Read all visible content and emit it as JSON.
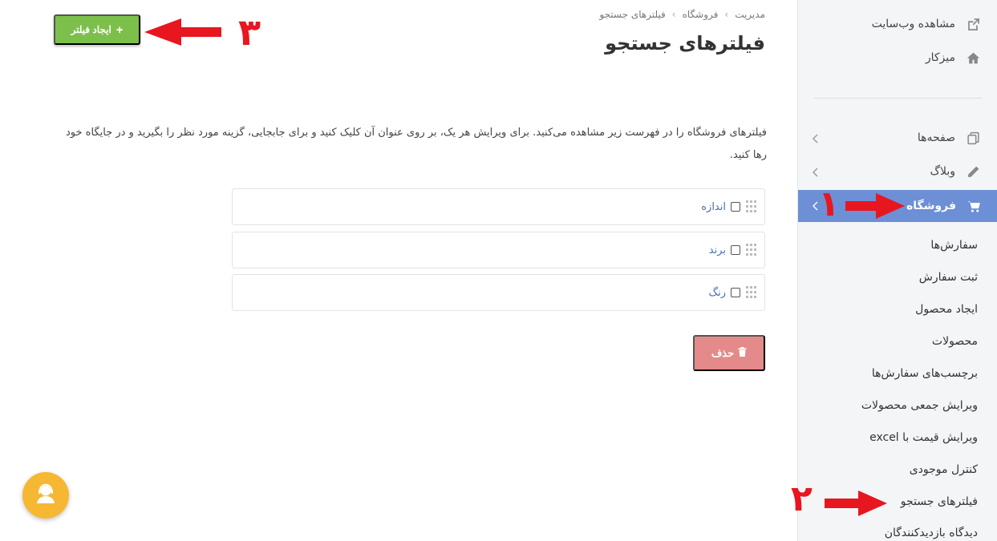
{
  "header": {
    "breadcrumb": [
      "مدیریت",
      "فروشگاه",
      "فیلترهای جستجو"
    ],
    "title": "فیلترهای جستجو",
    "create_button": "ایجاد فیلتر"
  },
  "description": "فیلترهای فروشگاه را در فهرست زیر مشاهده می‌کنید. برای ویرایش هر یک، بر روی عنوان آن کلیک کنید و برای جابجایی، گزینه مورد نظر را بگیرید و در جایگاه خود رها کنید.",
  "filters": [
    {
      "label": "اندازه",
      "checked": false
    },
    {
      "label": "برند",
      "checked": false
    },
    {
      "label": "رنگ",
      "checked": false
    }
  ],
  "delete_button": "حذف",
  "sidebar": {
    "top_links": [
      {
        "label": "مشاهده وب‌سایت",
        "icon": "external-link-icon"
      },
      {
        "label": "میزکار",
        "icon": "home-icon"
      }
    ],
    "sections": [
      {
        "label": "صفحه‌ها",
        "icon": "pages-icon"
      },
      {
        "label": "وبلاگ",
        "icon": "pencil-icon"
      },
      {
        "label": "فروشگاه",
        "icon": "cart-icon",
        "active": true
      }
    ],
    "shop_items": [
      "سفارش‌ها",
      "ثبت سفارش",
      "ایجاد محصول",
      "محصولات",
      "برچسب‌های سفارش‌ها",
      "ویرایش جمعی محصولات",
      "ویرایش قیمت با excel",
      "کنترل موجودی",
      "فیلترهای جستجو",
      "دیدگاه بازدیدکنندگان"
    ]
  },
  "annotations": {
    "n1": "۱",
    "n2": "۲",
    "n3": "۳",
    "color": "#e8161f"
  },
  "colors": {
    "active_nav": "#6c8fd6",
    "create_button": "#7cc04b",
    "delete_button": "#e48a8a",
    "help_button": "#f6b832"
  }
}
